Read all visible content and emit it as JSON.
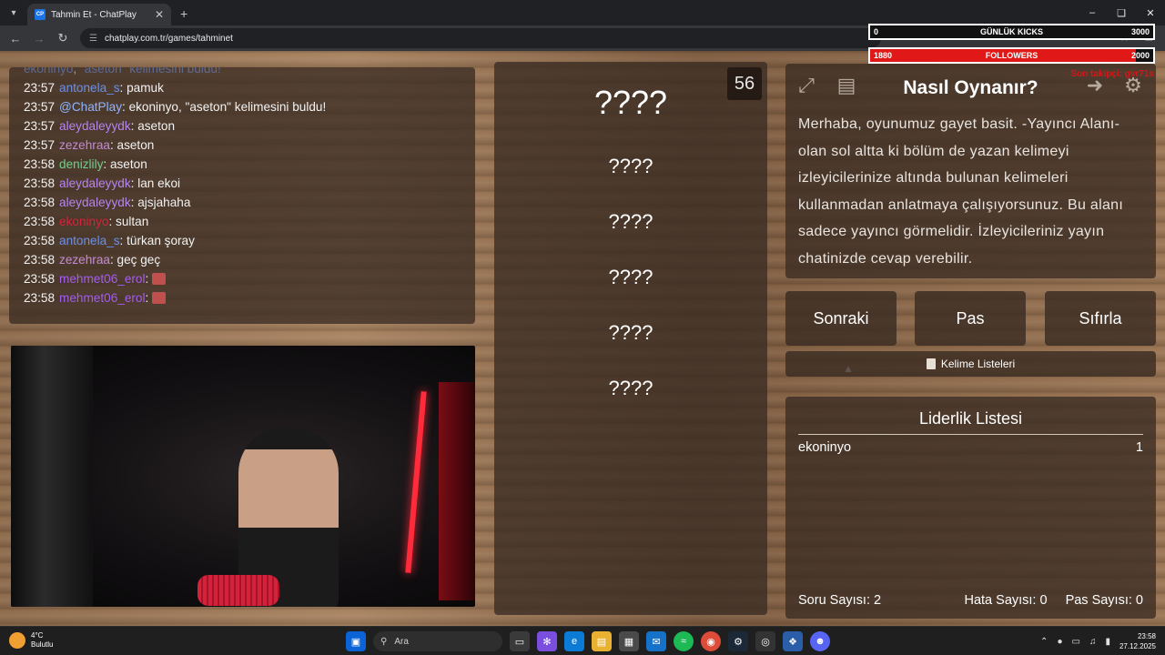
{
  "browser": {
    "tab_title": "Tahmin Et - ChatPlay",
    "favicon_text": "CP",
    "url": "chatplay.com.tr/games/tahminet"
  },
  "overlay": {
    "kicks": {
      "low": "0",
      "label": "GÜNLÜK KICKS",
      "high": "3000",
      "progress": 0.0
    },
    "followers": {
      "low": "1880",
      "label": "FOLLOWERS",
      "high": "2000",
      "progress": 0.94
    },
    "last_follower": "Son takipçi: gvr71s"
  },
  "chat": {
    "partial_line": {
      "user": "ekoninyo",
      "text": "\"aseton\" kelimesini buldu!"
    },
    "messages": [
      {
        "time": "23:57",
        "user": "antonela_s",
        "color": "#6b8fe8",
        "text": "pamuk"
      },
      {
        "time": "23:57",
        "user": "@ChatPlay",
        "color": "#8fb4ff",
        "text": "ekoninyo, \"aseton\" kelimesini buldu!"
      },
      {
        "time": "23:57",
        "user": "aleydaleyydk",
        "color": "#b784f0",
        "text": "aseton"
      },
      {
        "time": "23:57",
        "user": "zezehraa",
        "color": "#c58ad6",
        "text": "aseton"
      },
      {
        "time": "23:58",
        "user": "denizlily",
        "color": "#6fcf8a",
        "text": "aseton"
      },
      {
        "time": "23:58",
        "user": "aleydaleyydk",
        "color": "#b784f0",
        "text": "lan ekoi"
      },
      {
        "time": "23:58",
        "user": "aleydaleyydk",
        "color": "#b784f0",
        "text": "ajsjahaha"
      },
      {
        "time": "23:58",
        "user": "ekoninyo",
        "color": "#d6243b",
        "text": "sultan"
      },
      {
        "time": "23:58",
        "user": "antonela_s",
        "color": "#6b8fe8",
        "text": "türkan şoray"
      },
      {
        "time": "23:58",
        "user": "zezehraa",
        "color": "#c58ad6",
        "text": "geç geç"
      },
      {
        "time": "23:58",
        "user": "mehmet06_erol",
        "color": "#a55cf0",
        "text": ""
      },
      {
        "time": "23:58",
        "user": "mehmet06_erol",
        "color": "#a55cf0",
        "text": ""
      }
    ]
  },
  "game": {
    "counter": "56",
    "main_word": "????",
    "forbidden_words": [
      "????",
      "????",
      "????",
      "????",
      "????"
    ],
    "howto_title": "Nasıl Oynanır?",
    "howto_text": "Merhaba, oyunumuz gayet basit. -Yayıncı Alanı- olan sol altta ki bölüm de yazan kelimeyi izleyicilerinize altında bulunan kelimeleri kullanmadan anlatmaya çalışıyorsunuz. Bu alanı sadece yayıncı görmelidir. İzleyicileriniz yayın chatinizde cevap verebilir.",
    "buttons": {
      "next": "Sonraki",
      "pass": "Pas",
      "reset": "Sıfırla"
    },
    "word_lists_label": "Kelime Listeleri",
    "leaderboard": {
      "title": "Liderlik Listesi",
      "rows": [
        {
          "name": "ekoninyo",
          "score": "1"
        }
      ]
    },
    "stats": {
      "questions": "Soru Sayısı: 2",
      "errors": "Hata Sayısı: 0",
      "passes": "Pas Sayısı: 0"
    }
  },
  "taskbar": {
    "weather_temp": "4°C",
    "weather_desc": "Bulutlu",
    "search_placeholder": "Ara",
    "time": "23:58",
    "date": "27.12.2025"
  },
  "icons": [
    "search-icon",
    "back-icon",
    "forward-icon",
    "reload-icon",
    "fullscreen-icon",
    "notes-icon",
    "exit-icon",
    "gear-icon",
    "windows-icon"
  ]
}
